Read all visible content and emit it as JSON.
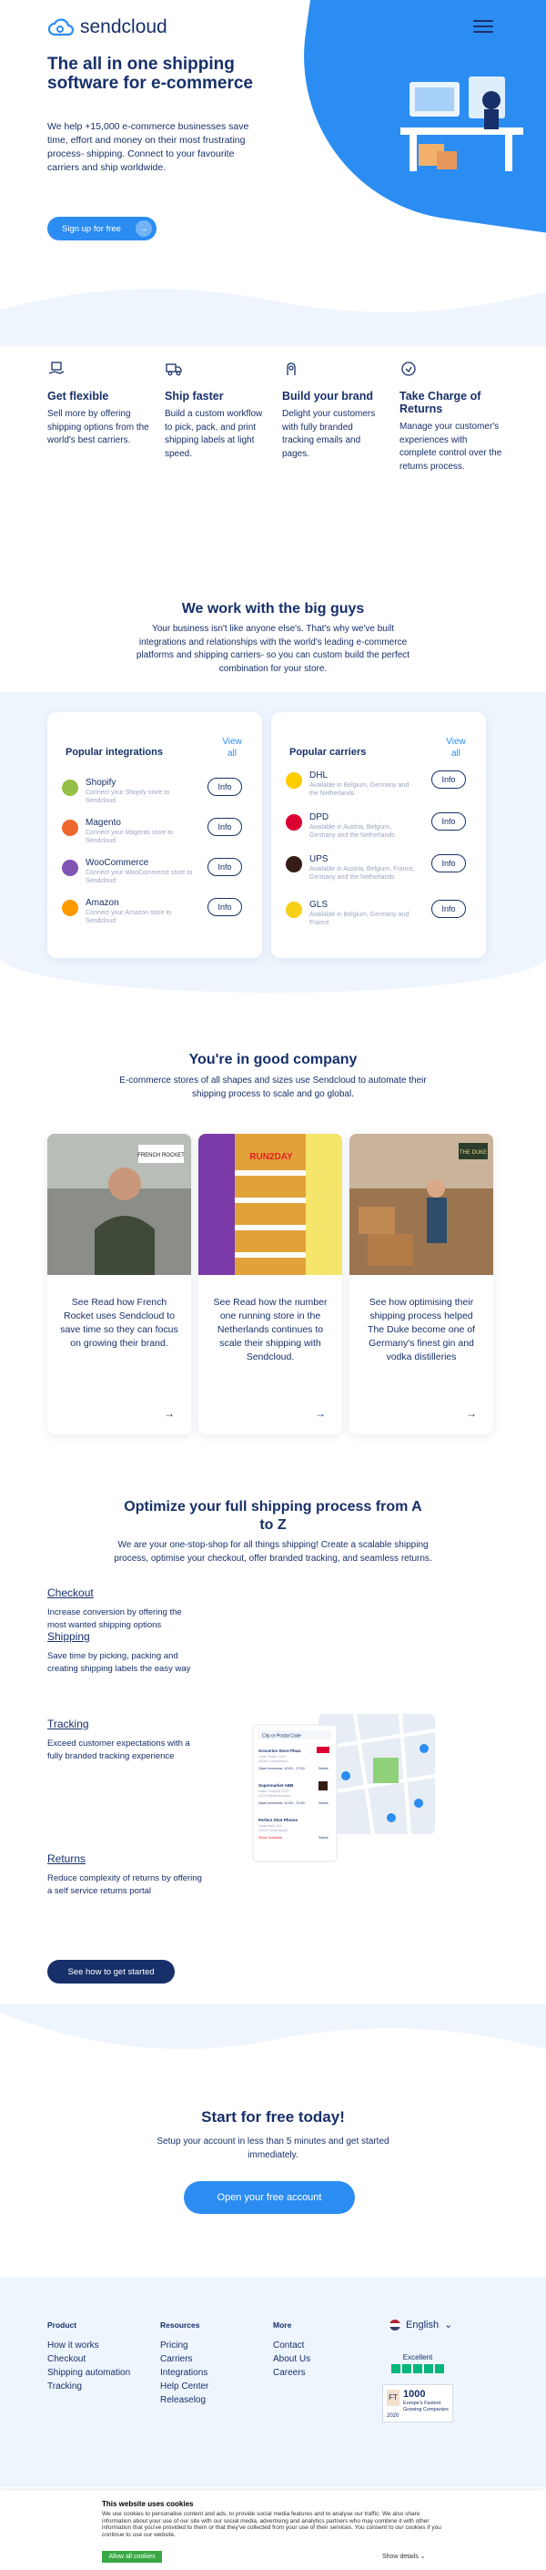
{
  "header": {
    "logo_text": "sendcloud",
    "title": "The all in one shipping software for e-commerce",
    "subtitle": "We help +15,000 e-commerce businesses save time, effort and money on their most frustrating process- shipping. Connect to your favourite carriers and ship worldwide.",
    "signup_label": "Sign up for free"
  },
  "features": [
    {
      "icon": "box-hand-icon",
      "title": "Get flexible",
      "text": "Sell more by offering shipping options from the world's best carriers."
    },
    {
      "icon": "truck-icon",
      "title": "Ship faster",
      "text": "Build a custom workflow to pick, pack, and print shipping labels at light speed."
    },
    {
      "icon": "brand-icon",
      "title": "Build your brand",
      "text": "Delight your customers with fully branded tracking emails and pages."
    },
    {
      "icon": "returns-icon",
      "title": "Take Charge of Returns",
      "text": "Manage your customer's experiences with complete control over the returns process."
    }
  ],
  "big_guys": {
    "title": "We work with the big guys",
    "text": "Your business isn't like anyone else's. That's why we've built integrations and relationships with the world's leading e-commerce platforms and shipping carriers- so you can custom build the perfect combination for your store."
  },
  "integrations": {
    "title": "Popular integrations",
    "view_all": "View all",
    "items": [
      {
        "name": "Shopify",
        "desc": "Connect your Shopify store to Sendcloud",
        "color": "#95bf47",
        "button": "Info"
      },
      {
        "name": "Magento",
        "desc": "Connect your Magento store to Sendcloud",
        "color": "#ee672f",
        "button": "Info"
      },
      {
        "name": "WooCommerce",
        "desc": "Connect your WooCommerce store to Sendcloud",
        "color": "#7f54b3",
        "button": "Info"
      },
      {
        "name": "Amazon",
        "desc": "Connect your Amazon store to Sendcloud",
        "color": "#ff9900",
        "button": "Info"
      }
    ]
  },
  "carriers": {
    "title": "Popular carriers",
    "view_all": "View all",
    "items": [
      {
        "name": "DHL",
        "desc": "Available in Belgium, Germany and the Netherlands",
        "color": "#ffcc00",
        "button": "Info"
      },
      {
        "name": "DPD",
        "desc": "Available in Austria, Belgium, Germany and the Netherlands",
        "color": "#dc0032",
        "button": "Info"
      },
      {
        "name": "UPS",
        "desc": "Available in Austria, Belgium, France, Germany and the Netherlands",
        "color": "#351c15",
        "button": "Info"
      },
      {
        "name": "GLS",
        "desc": "Available in Belgium, Germany and France",
        "color": "#f7d117",
        "button": "Info"
      }
    ]
  },
  "good_company": {
    "title": "You're in good company",
    "text": "E-commerce stores of all shapes and sizes use Sendcloud to automate their shipping process to scale and go global.",
    "stories": [
      {
        "text": "See Read how French Rocket uses Sendcloud to save time so they can focus on growing their brand.",
        "badge": "FRENCH ROCKET"
      },
      {
        "text": "See Read how the number one running store in the Netherlands continues to scale their shipping with Sendcloud.",
        "badge": "RUN2DAY"
      },
      {
        "text": "See how optimising their shipping process helped The Duke become one of Germany's finest gin and vodka distilleries",
        "badge": "THE DUKE"
      }
    ]
  },
  "optimize": {
    "title": "Optimize your full shipping process from A to Z",
    "text": "We are your one-stop-shop for all things shipping! Create a scalable shipping process, optimise your checkout, offer branded tracking, and seamless returns.",
    "items": [
      {
        "title": "Checkout",
        "text": "Increase conversion by offering the most wanted shipping options"
      },
      {
        "title": "Shipping",
        "text": "Save time by picking, packing and creating shipping labels the easy way"
      },
      {
        "title": "Tracking",
        "text": "Exceed customer expectations with a fully branded tracking experience"
      },
      {
        "title": "Returns",
        "text": "Reduce complexity of returns by offering a self service returns portal"
      }
    ],
    "button": "See how to get started",
    "mock": {
      "search": "City or Postal Code",
      "rows": [
        {
          "name": "Groceries Store Plaza",
          "line2": "Calle Fisher 1324",
          "line3": "31040 Lindenbaum",
          "meta": "Open tomorrow: 10:00 - 17:00",
          "link": "Select"
        },
        {
          "name": "Supermarket ABB",
          "line2": "Kailer Leopold 1175",
          "line3": "31794 Berlinshausen",
          "meta": "Open tomorrow: 10:00 - 17:00",
          "link": "Select"
        },
        {
          "name": "Perfect Shot Photos",
          "line2": "Kaiserdam 144",
          "line3": "11213 Lindenbaum",
          "meta": "Show Schedule",
          "link": "Select"
        }
      ]
    }
  },
  "cta": {
    "title": "Start for free today!",
    "text": "Setup your account in less than 5 minutes and get started immediately.",
    "button": "Open your free account"
  },
  "footer": {
    "columns": [
      {
        "title": "Product",
        "links": [
          "How it works",
          "Checkout",
          "Shipping automation",
          "Tracking"
        ]
      },
      {
        "title": "Resources",
        "links": [
          "Pricing",
          "Carriers",
          "Integrations",
          "Help Center",
          "Releaselog"
        ]
      },
      {
        "title": "More",
        "links": [
          "Contact",
          "About Us",
          "Careers"
        ]
      }
    ],
    "language": "English",
    "trustpilot": "Excellent",
    "ft_number": "1000",
    "ft_text": "Europe's Fastest Growing Companies",
    "ft_year": "2020",
    "ft_mark": "FT"
  },
  "cookie": {
    "title": "This website uses cookies",
    "text": "We use cookies to personalise content and ads, to provide social media features and to analyse our traffic. We also share information about your use of our site with our social media, advertising and analytics partners who may combine it with other information that you've provided to them or that they've collected from your use of their services. You consent to our cookies if you continue to use our website.",
    "allow": "Allow all cookies",
    "details": "Show details"
  },
  "colors": {
    "primary": "#2b8df2",
    "navy": "#17306a",
    "light_band": "#eef5fd"
  }
}
